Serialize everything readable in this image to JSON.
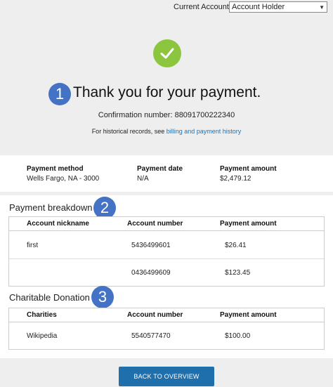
{
  "header": {
    "account_label": "Current Account:",
    "account_selected": "Account Holder"
  },
  "confirmation": {
    "step1": "1",
    "thanks": "Thank you for your payment.",
    "confirmation_text": "Confirmation number: 88091700222340",
    "historical_prefix": "For historical records, see ",
    "historical_link": "billing and payment history"
  },
  "summary": {
    "method_label": "Payment method",
    "method_value": "Wells Fargo, NA - 3000",
    "date_label": "Payment date",
    "date_value": "N/A",
    "amount_label": "Payment amount",
    "amount_value": "$2,479.12"
  },
  "breakdown": {
    "title": "Payment breakdown",
    "step2": "2",
    "headers": [
      "Account nickname",
      "Account number",
      "Payment amount"
    ],
    "rows": [
      {
        "nickname": "first",
        "number": "5436499601",
        "amount": "$26.41"
      },
      {
        "nickname": "",
        "number": "0436499609",
        "amount": "$123.45"
      }
    ]
  },
  "donation": {
    "title": "Charitable Donation",
    "step3": "3",
    "headers": [
      "Charities",
      "Account number",
      "Payment amount"
    ],
    "rows": [
      {
        "name": "Wikipedia",
        "number": "5540577470",
        "amount": "$100.00"
      }
    ]
  },
  "footer": {
    "back_label": "BACK TO OVERVIEW"
  },
  "colors": {
    "success": "#8cc63f",
    "badge": "#4472c4",
    "primary_button": "#1f6fad",
    "link": "#1a73b8"
  }
}
